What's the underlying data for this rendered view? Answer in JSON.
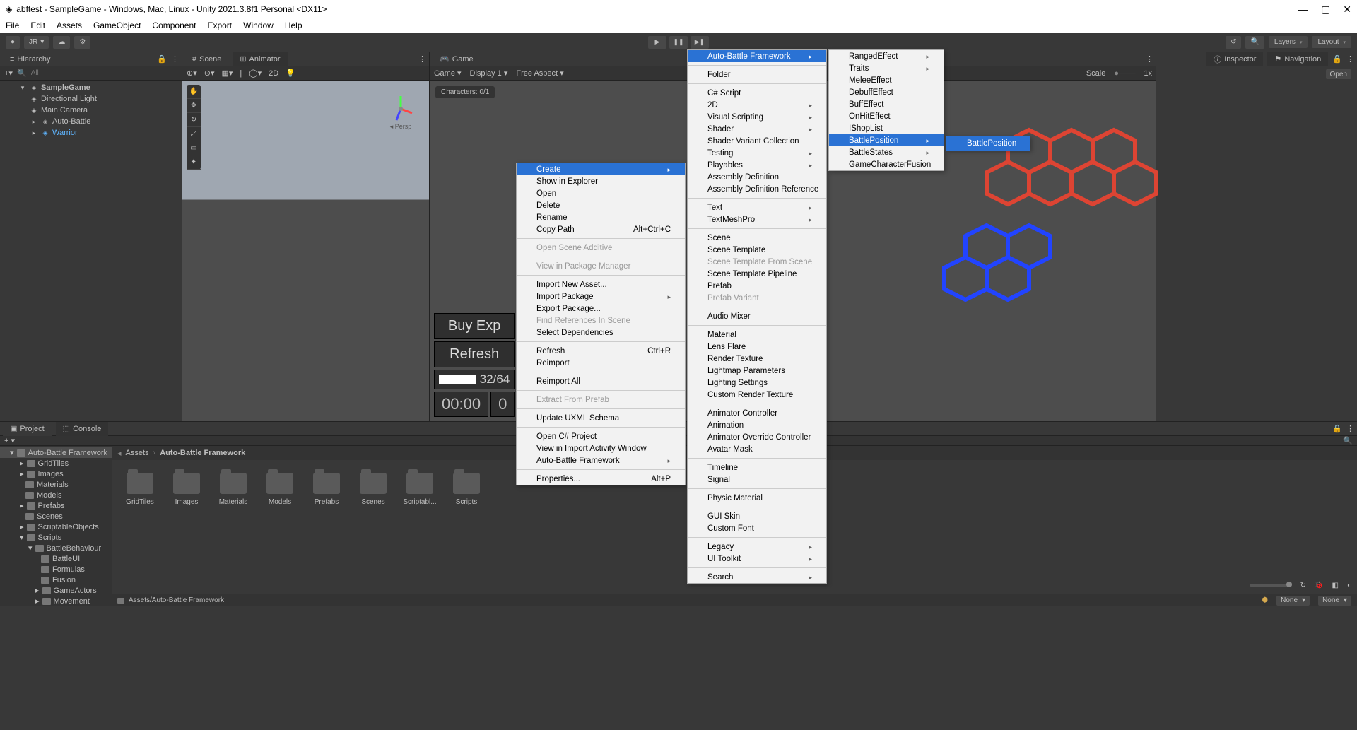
{
  "title": "abftest - SampleGame - Windows, Mac, Linux - Unity 2021.3.8f1 Personal <DX11>",
  "menubar": [
    "File",
    "Edit",
    "Assets",
    "GameObject",
    "Component",
    "Export",
    "Window",
    "Help"
  ],
  "toolbar": {
    "account": "JR",
    "layers": "Layers",
    "layout": "Layout"
  },
  "hierarchy": {
    "label": "Hierarchy",
    "search_placeholder": "All",
    "root": "SampleGame",
    "items": [
      "Directional Light",
      "Main Camera",
      "Auto-Battle",
      "Warrior"
    ]
  },
  "scene": {
    "tab1": "Scene",
    "tab2": "Animator",
    "mode": "2D",
    "persp": "Persp"
  },
  "game": {
    "tab": "Game",
    "mode": "Game",
    "display": "Display 1",
    "aspect": "Free Aspect",
    "scale_label": "Scale",
    "scale_val": "1x",
    "characters": "Characters: 0/1",
    "btn_buy": "Buy Exp",
    "btn_refresh": "Refresh",
    "bar_text": "32/64",
    "time": "00:00",
    "score": "0"
  },
  "inspector": {
    "tab1": "Inspector",
    "tab2": "Navigation",
    "open": "Open"
  },
  "project": {
    "tab1": "Project",
    "tab2": "Console",
    "tree_root": "Auto-Battle Framework",
    "tree": [
      "GridTiles",
      "Images",
      "Materials",
      "Models",
      "Prefabs",
      "Scenes",
      "ScriptableObjects",
      "Scripts"
    ],
    "tree_sub": [
      "BattleBehaviour",
      "BattleUI",
      "Formulas",
      "Fusion",
      "GameActors",
      "Movement"
    ],
    "breadcrumb": [
      "Assets",
      "Auto-Battle Framework"
    ],
    "folders": [
      "GridTiles",
      "Images",
      "Materials",
      "Models",
      "Prefabs",
      "Scenes",
      "Scriptabl...",
      "Scripts"
    ],
    "footer_path": "Assets/Auto-Battle Framework",
    "dd_none": "None"
  },
  "ctx1": {
    "items": [
      {
        "t": "Create",
        "hl": true,
        "sub": true
      },
      {
        "t": "Show in Explorer"
      },
      {
        "t": "Open"
      },
      {
        "t": "Delete"
      },
      {
        "t": "Rename"
      },
      {
        "t": "Copy Path",
        "sc": "Alt+Ctrl+C"
      },
      {
        "sep": true
      },
      {
        "t": "Open Scene Additive",
        "dis": true
      },
      {
        "sep": true
      },
      {
        "t": "View in Package Manager",
        "dis": true
      },
      {
        "sep": true
      },
      {
        "t": "Import New Asset..."
      },
      {
        "t": "Import Package",
        "sub": true
      },
      {
        "t": "Export Package..."
      },
      {
        "t": "Find References In Scene",
        "dis": true
      },
      {
        "t": "Select Dependencies"
      },
      {
        "sep": true
      },
      {
        "t": "Refresh",
        "sc": "Ctrl+R"
      },
      {
        "t": "Reimport"
      },
      {
        "sep": true
      },
      {
        "t": "Reimport All"
      },
      {
        "sep": true
      },
      {
        "t": "Extract From Prefab",
        "dis": true
      },
      {
        "sep": true
      },
      {
        "t": "Update UXML Schema"
      },
      {
        "sep": true
      },
      {
        "t": "Open C# Project"
      },
      {
        "t": "View in Import Activity Window"
      },
      {
        "t": "Auto-Battle Framework",
        "sub": true
      },
      {
        "sep": true
      },
      {
        "t": "Properties...",
        "sc": "Alt+P"
      }
    ]
  },
  "ctx2": {
    "items": [
      {
        "t": "Auto-Battle Framework",
        "hl": true,
        "sub": true
      },
      {
        "sep": true
      },
      {
        "t": "Folder"
      },
      {
        "sep": true
      },
      {
        "t": "C# Script"
      },
      {
        "t": "2D",
        "sub": true
      },
      {
        "t": "Visual Scripting",
        "sub": true
      },
      {
        "t": "Shader",
        "sub": true
      },
      {
        "t": "Shader Variant Collection"
      },
      {
        "t": "Testing",
        "sub": true
      },
      {
        "t": "Playables",
        "sub": true
      },
      {
        "t": "Assembly Definition"
      },
      {
        "t": "Assembly Definition Reference"
      },
      {
        "sep": true
      },
      {
        "t": "Text",
        "sub": true
      },
      {
        "t": "TextMeshPro",
        "sub": true
      },
      {
        "sep": true
      },
      {
        "t": "Scene"
      },
      {
        "t": "Scene Template"
      },
      {
        "t": "Scene Template From Scene",
        "dis": true
      },
      {
        "t": "Scene Template Pipeline"
      },
      {
        "t": "Prefab"
      },
      {
        "t": "Prefab Variant",
        "dis": true
      },
      {
        "sep": true
      },
      {
        "t": "Audio Mixer"
      },
      {
        "sep": true
      },
      {
        "t": "Material"
      },
      {
        "t": "Lens Flare"
      },
      {
        "t": "Render Texture"
      },
      {
        "t": "Lightmap Parameters"
      },
      {
        "t": "Lighting Settings"
      },
      {
        "t": "Custom Render Texture"
      },
      {
        "sep": true
      },
      {
        "t": "Animator Controller"
      },
      {
        "t": "Animation"
      },
      {
        "t": "Animator Override Controller"
      },
      {
        "t": "Avatar Mask"
      },
      {
        "sep": true
      },
      {
        "t": "Timeline"
      },
      {
        "t": "Signal"
      },
      {
        "sep": true
      },
      {
        "t": "Physic Material"
      },
      {
        "sep": true
      },
      {
        "t": "GUI Skin"
      },
      {
        "t": "Custom Font"
      },
      {
        "sep": true
      },
      {
        "t": "Legacy",
        "sub": true
      },
      {
        "t": "UI Toolkit",
        "sub": true
      },
      {
        "sep": true
      },
      {
        "t": "Search",
        "sub": true
      }
    ]
  },
  "ctx3": {
    "items": [
      {
        "t": "RangedEffect",
        "sub": true
      },
      {
        "t": "Traits",
        "sub": true
      },
      {
        "t": "MeleeEffect"
      },
      {
        "t": "DebuffEffect"
      },
      {
        "t": "BuffEffect"
      },
      {
        "t": "OnHitEffect"
      },
      {
        "t": "IShopList"
      },
      {
        "t": "BattlePosition",
        "hl": true,
        "sub": true
      },
      {
        "t": "BattleStates",
        "sub": true
      },
      {
        "t": "GameCharacterFusion"
      }
    ]
  },
  "ctx4": {
    "items": [
      {
        "t": "BattlePosition",
        "hl": true
      }
    ]
  }
}
